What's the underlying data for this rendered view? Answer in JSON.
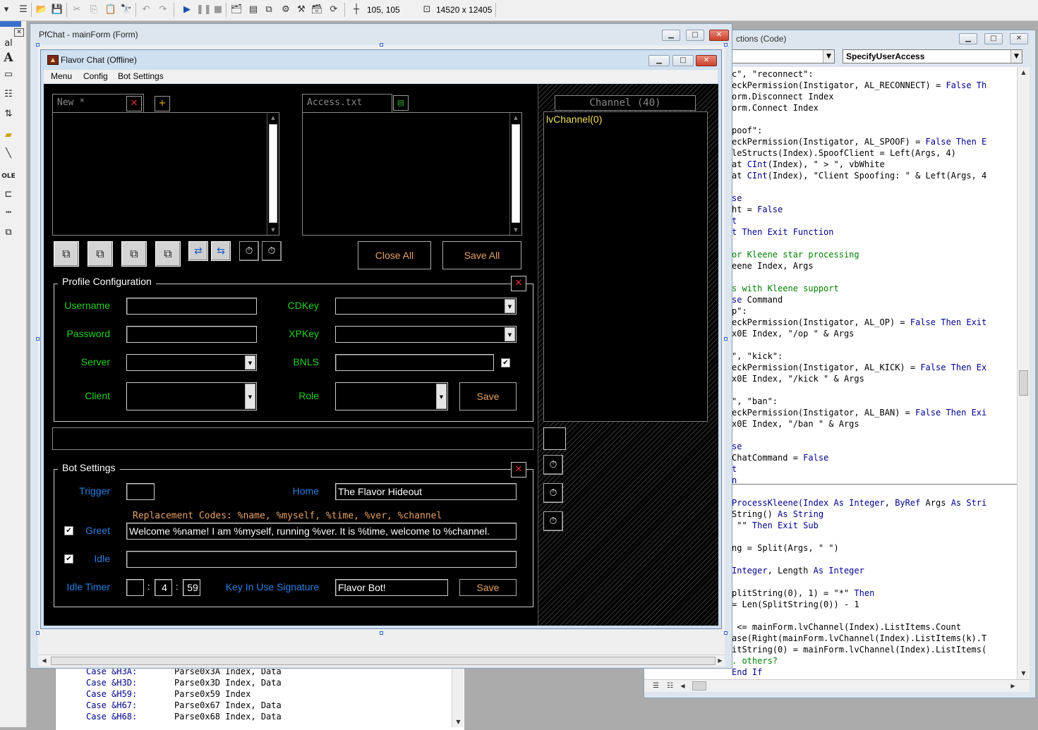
{
  "ide": {
    "toolbar": {
      "icons": [
        "dropdown-arrow-icon",
        "menu-editor-icon",
        "open-project-icon",
        "save-project-icon",
        "cut-icon",
        "copy-icon",
        "paste-icon",
        "find-icon",
        "undo-icon",
        "redo-icon",
        "start-icon",
        "break-icon",
        "end-icon",
        "project-explorer-icon",
        "properties-icon",
        "form-layout-icon",
        "object-browser-icon",
        "toolbox-icon",
        "data-view-icon",
        "visual-component-manager-icon"
      ],
      "position_readout": "105, 105",
      "size_readout": "14520 x 12405"
    },
    "toolbox_tools": [
      "pointer-tool",
      "label-tool",
      "frame-tool",
      "listbox-tool",
      "combobox-tool",
      "folder-tool",
      "line-tool",
      "ole-tool",
      "data-tool",
      "menu-tool",
      "control-tool"
    ],
    "code_window": {
      "title": "ctions (Code)",
      "object_combo": "",
      "procedure_combo": "SpecifyUserAccess",
      "lines": [
        [
          {
            "t": "c\", \"reconnect\":"
          }
        ],
        [
          {
            "t": "eckPermission(Instigator, AL_RECONNECT) = "
          },
          {
            "t": "False",
            "k": 1
          },
          {
            "t": " Th",
            "k": 1
          }
        ],
        [
          {
            "t": "orm.Disconnect Index"
          }
        ],
        [
          {
            "t": "orm.Connect Index"
          }
        ],
        [
          {
            "t": ""
          }
        ],
        [
          {
            "t": "poof\":"
          }
        ],
        [
          {
            "t": "eckPermission(Instigator, AL_SPOOF) = "
          },
          {
            "t": "False Then E",
            "k": 1
          }
        ],
        [
          {
            "t": "leStructs(Index).SpoofClient = Left(Args, 4)"
          }
        ],
        [
          {
            "t": "at "
          },
          {
            "t": "CInt",
            "k": 1
          },
          {
            "t": "(Index), \" > \", vbWhite"
          }
        ],
        [
          {
            "t": "at "
          },
          {
            "t": "CInt",
            "k": 1
          },
          {
            "t": "(Index), \"Client Spoofing: \" & Left(Args, 4"
          }
        ],
        [
          {
            "t": ""
          }
        ],
        [
          {
            "t": "se",
            "k": 1
          }
        ],
        [
          {
            "t": "ht = "
          },
          {
            "t": "False",
            "k": 1
          }
        ],
        [
          {
            "t": "t",
            "k": 1
          }
        ],
        [
          {
            "t": "t ",
            "k": 1
          },
          {
            "t": "Then Exit Function",
            "k": 1
          }
        ],
        [
          {
            "t": ""
          }
        ],
        [
          {
            "t": "or Kleene star processing",
            "c": 1
          }
        ],
        [
          {
            "t": "eene Index, Args"
          }
        ],
        [
          {
            "t": ""
          }
        ],
        [
          {
            "t": "s with Kleene support",
            "c": 1
          }
        ],
        [
          {
            "t": "se",
            "k": 1
          },
          {
            "t": " Command"
          }
        ],
        [
          {
            "t": "p\":"
          }
        ],
        [
          {
            "t": "eckPermission(Instigator, AL_OP) = "
          },
          {
            "t": "False Then Exit",
            "k": 1
          }
        ],
        [
          {
            "t": "x0E Index, \"/op \" & Args"
          }
        ],
        [
          {
            "t": ""
          }
        ],
        [
          {
            "t": "\", \"kick\":"
          }
        ],
        [
          {
            "t": "eckPermission(Instigator, AL_KICK) = "
          },
          {
            "t": "False Then Ex",
            "k": 1
          }
        ],
        [
          {
            "t": "x0E Index, \"/kick \" & Args"
          }
        ],
        [
          {
            "t": ""
          }
        ],
        [
          {
            "t": "\", \"ban\":"
          }
        ],
        [
          {
            "t": "eckPermission(Instigator, AL_BAN) = "
          },
          {
            "t": "False Then Exi",
            "k": 1
          }
        ],
        [
          {
            "t": "x0E Index, \"/ban \" & Args"
          }
        ],
        [
          {
            "t": ""
          }
        ],
        [
          {
            "t": "se",
            "k": 1
          }
        ],
        [
          {
            "t": "ChatCommand = "
          },
          {
            "t": "False",
            "k": 1
          }
        ],
        [
          {
            "t": "t",
            "k": 1
          }
        ],
        [
          {
            "t": "n",
            "k": 1
          }
        ],
        [
          {
            "t": ""
          }
        ],
        [
          {
            "t": "ProcessKleene(Index ",
            "k": 1
          },
          {
            "t": "As Integer",
            "k": 1
          },
          {
            "t": ", "
          },
          {
            "t": "ByRef",
            "k": 1
          },
          {
            "t": " Args "
          },
          {
            "t": "As Stri",
            "k": 1
          }
        ],
        [
          {
            "t": "String() "
          },
          {
            "t": "As String",
            "k": 1
          }
        ],
        [
          {
            "t": " \"\" "
          },
          {
            "t": "Then Exit Sub",
            "k": 1
          }
        ],
        [
          {
            "t": ""
          }
        ],
        [
          {
            "t": "ng = Split(Args, \" \")"
          }
        ],
        [
          {
            "t": ""
          }
        ],
        [
          {
            "t": "Integer",
            "k": 1
          },
          {
            "t": ", Length "
          },
          {
            "t": "As Integer",
            "k": 1
          }
        ],
        [
          {
            "t": ""
          }
        ],
        [
          {
            "t": "plitString(0), 1) = \"*\" "
          },
          {
            "t": "Then",
            "k": 1
          }
        ],
        [
          {
            "t": "= Len(SplitString(0)) - 1"
          }
        ],
        [
          {
            "t": ""
          }
        ],
        [
          {
            "t": " <= mainForm.lvChannel(Index).ListItems.Count"
          }
        ],
        [
          {
            "t": "ase(Right(mainForm.lvChannel(Index).ListItems(k).T"
          }
        ],
        [
          {
            "t": "itString(0) = mainForm.lvChannel(Index).ListItems("
          }
        ],
        [
          {
            "t": ". others?",
            "c": 1
          }
        ],
        [
          {
            "t": "End If",
            "k": 1
          }
        ]
      ]
    },
    "bottom_code": [
      {
        "case": "Case &H3A:",
        "call": "Parse0x3A Index, Data"
      },
      {
        "case": "Case &H3D:",
        "call": "Parse0x3D Index, Data"
      },
      {
        "case": "Case &H59:",
        "call": "Parse0x59 Index"
      },
      {
        "case": "Case &H67:",
        "call": "Parse0x67 Index, Data"
      },
      {
        "case": "Case &H68:",
        "call": "Parse0x68 Index, Data"
      }
    ],
    "designer_title": "PfChat - mainForm (Form)"
  },
  "form": {
    "title": "Flavor Chat (Offline)",
    "menu": [
      "Menu",
      "Config",
      "Bot Settings"
    ],
    "tabs": {
      "new_tab": "New *",
      "add_tab": "+",
      "access_tab": "Access.txt"
    },
    "buttons": {
      "close_all": "Close All",
      "save_all": "Save All"
    },
    "channel": {
      "header": "Channel (40)",
      "items": [
        "lvChannel(0)"
      ]
    },
    "profile": {
      "title": "Profile Configuration",
      "username_label": "Username",
      "password_label": "Password",
      "server_label": "Server",
      "client_label": "Client",
      "cdkey_label": "CDKey",
      "xpkey_label": "XPKey",
      "bnls_label": "BNLS",
      "role_label": "Role",
      "username": "",
      "password": "",
      "server": "",
      "client": "",
      "cdkey": "",
      "xpkey": "",
      "bnls": "",
      "role": "",
      "bnls_checked": true,
      "save": "Save"
    },
    "bot": {
      "title": "Bot Settings",
      "trigger_label": "Trigger",
      "trigger": "",
      "home_label": "Home",
      "home": "The Flavor Hideout",
      "replacement_codes": "Replacement Codes: %name, %myself, %time, %ver, %channel",
      "greet_label": "Greet",
      "greet_checked": true,
      "greet": "Welcome %name! I am %myself, running %ver.  It is %time, welcome to %channel.",
      "idle_label": "Idle",
      "idle_checked": true,
      "idle": "",
      "idle_timer_label": "Idle Timer",
      "idle_hours": "",
      "idle_minutes": "4",
      "idle_seconds": "59",
      "key_in_use_label": "Key In Use Signature",
      "key_in_use": "Flavor Bot!",
      "save": "Save"
    }
  }
}
